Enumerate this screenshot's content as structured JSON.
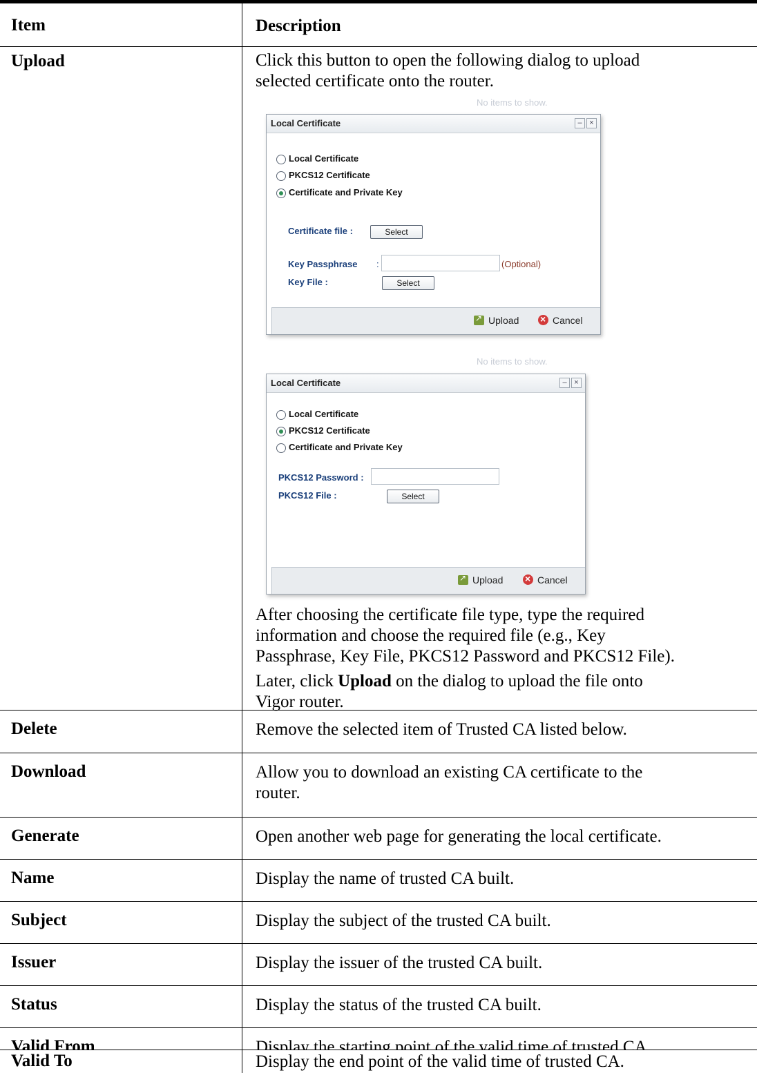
{
  "header": {
    "item": "Item",
    "description": "Description"
  },
  "upload_row": {
    "item": "Upload",
    "desc_line1": "Click this button to open the following dialog to upload",
    "desc_line2": "selected certificate onto the router.",
    "after_line1": "After choosing the certificate file type, type the required",
    "after_line2": "information and choose the required file (e.g., Key",
    "after_line3": "Passphrase, Key File, PKCS12 Password and PKCS12 File).",
    "later_prefix": "Later, click ",
    "later_bold": "Upload",
    "later_suffix": " on the dialog to upload the file onto",
    "later_line2": "Vigor router."
  },
  "dialog1": {
    "ghost_text": "No items to show.",
    "title": "Local Certificate",
    "options": [
      "Local Certificate",
      "PKCS12 Certificate",
      "Certificate and Private Key"
    ],
    "selected": "Certificate and Private Key",
    "cert_file_label": "Certificate file :",
    "select_label": "Select",
    "key_pass_label": "Key Passphrase",
    "key_pass_colon": ":",
    "optional": "(Optional)",
    "key_file_label": "Key File :",
    "key_file_select": "Select",
    "upload": "Upload",
    "cancel": "Cancel"
  },
  "dialog2": {
    "ghost_text": "No items to show.",
    "title": "Local Certificate",
    "options": [
      "Local Certificate",
      "PKCS12 Certificate",
      "Certificate and Private Key"
    ],
    "selected": "PKCS12 Certificate",
    "pkcs_pass_label": "PKCS12 Password :",
    "pkcs_file_label": "PKCS12 File :",
    "select_label": "Select",
    "upload": "Upload",
    "cancel": "Cancel"
  },
  "rows": [
    {
      "item": "Delete",
      "desc1": "Remove the selected item of Trusted CA listed below.",
      "desc2": ""
    },
    {
      "item": "Download",
      "desc1": "Allow you to download an existing CA certificate to the",
      "desc2": "router."
    },
    {
      "item": "Generate",
      "desc1": "Open another web page for generating the local certificate.",
      "desc2": ""
    },
    {
      "item": "Name",
      "desc1": "Display the name of trusted CA built.",
      "desc2": ""
    },
    {
      "item": "Subject",
      "desc1": "Display the subject of the trusted CA built.",
      "desc2": ""
    },
    {
      "item": "Issuer",
      "desc1": "Display the issuer of the trusted CA built.",
      "desc2": ""
    },
    {
      "item": "Status",
      "desc1": "Display the status of the trusted CA built.",
      "desc2": ""
    },
    {
      "item": "Valid From",
      "desc1": "Display the starting point of the valid time of trusted CA.",
      "desc2": ""
    },
    {
      "item": "Valid To",
      "desc1": "Display the end point of the valid time of trusted CA.",
      "desc2": ""
    }
  ]
}
